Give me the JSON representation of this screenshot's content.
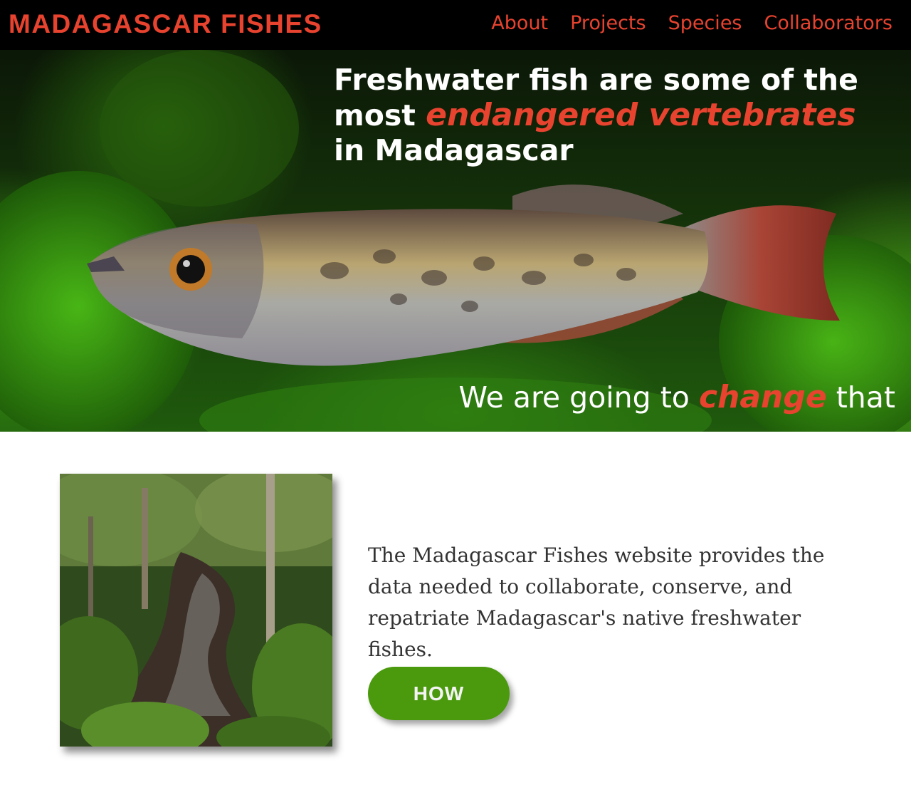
{
  "header": {
    "brand": "MADAGASCAR FISHES",
    "nav": [
      {
        "label": "About"
      },
      {
        "label": "Projects"
      },
      {
        "label": "Species"
      },
      {
        "label": "Collaborators"
      }
    ]
  },
  "hero": {
    "headline_part1": "Freshwater fish are some of the most ",
    "headline_accent": "endangered vertebrates",
    "headline_part2": " in Madagascar",
    "tagline_part1": "We are going to ",
    "tagline_accent": "change",
    "tagline_part2": " that"
  },
  "intro": {
    "text": "The Madagascar Fishes website provides the data needed to collaborate, conserve, and repatriate Madagascar's native freshwater fishes.",
    "button_label": "HOW"
  },
  "colors": {
    "brand_red": "#e8432f",
    "nav_background": "#000000",
    "button_green": "#4b9a0e",
    "body_text": "#333333"
  },
  "images": {
    "hero": "fish-photo",
    "feature": "forest-stream-photo"
  }
}
